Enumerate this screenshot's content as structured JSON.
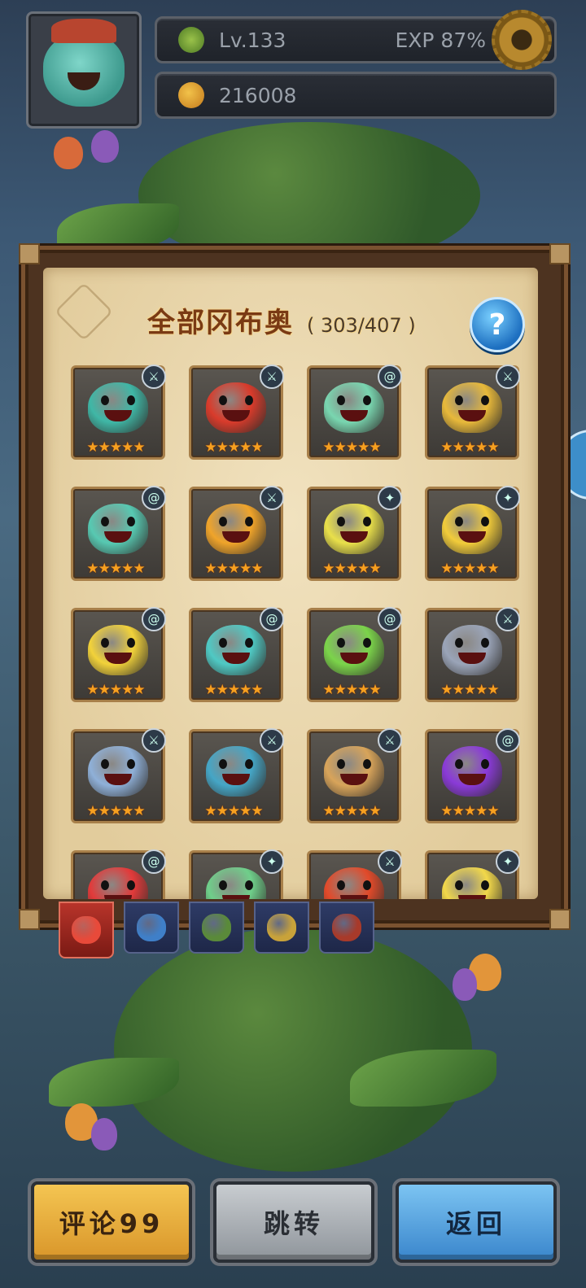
{
  "hud": {
    "level_text": "Lv.133",
    "exp_text": "EXP 87%",
    "coins_text": "216008"
  },
  "panel": {
    "title": "全部冈布奥",
    "count": "( 303/407 )",
    "help_label": "?"
  },
  "cards": [
    {
      "badge": "sword",
      "color": "#3fb7a6",
      "stars": "★★★★★"
    },
    {
      "badge": "sword",
      "color": "#d93b2b",
      "stars": "★★★★★"
    },
    {
      "badge": "spiral",
      "color": "#79d6b0",
      "stars": "★★★★★"
    },
    {
      "badge": "sword",
      "color": "#e8b93a",
      "stars": "★★★★★"
    },
    {
      "badge": "spiral",
      "color": "#57c9b2",
      "stars": "★★★★★"
    },
    {
      "badge": "sword",
      "color": "#f0a42a",
      "stars": "★★★★★"
    },
    {
      "badge": "wand",
      "color": "#e9e04a",
      "stars": "★★★★★"
    },
    {
      "badge": "wand",
      "color": "#f2cc3a",
      "stars": "★★★★★"
    },
    {
      "badge": "spiral",
      "color": "#f2d23a",
      "stars": "★★★★★"
    },
    {
      "badge": "spiral",
      "color": "#4fc9c4",
      "stars": "★★★★★"
    },
    {
      "badge": "spiral",
      "color": "#7bd44a",
      "stars": "★★★★★"
    },
    {
      "badge": "sword",
      "color": "#9aa4b8",
      "stars": "★★★★★"
    },
    {
      "badge": "sword",
      "color": "#8fb0d8",
      "stars": "★★★★★"
    },
    {
      "badge": "sword",
      "color": "#45a6c6",
      "stars": "★★★★★"
    },
    {
      "badge": "sword",
      "color": "#d8a45a",
      "stars": "★★★★★"
    },
    {
      "badge": "spiral",
      "color": "#8a3ad8",
      "stars": "★★★★★"
    },
    {
      "badge": "spiral",
      "color": "#e23a3a",
      "stars": ""
    },
    {
      "badge": "wand",
      "color": "#6fcf8a",
      "stars": ""
    },
    {
      "badge": "sword",
      "color": "#e24a2a",
      "stars": ""
    },
    {
      "badge": "wand",
      "color": "#f2d84a",
      "stars": ""
    }
  ],
  "tabs": [
    {
      "name": "all",
      "active": true,
      "color": "#e84a3a"
    },
    {
      "name": "blue",
      "active": false,
      "color": "#3f7fc8"
    },
    {
      "name": "green",
      "active": false,
      "color": "#5a8a3a"
    },
    {
      "name": "gold",
      "active": false,
      "color": "#c8a23a"
    },
    {
      "name": "red",
      "active": false,
      "color": "#a83a2a"
    }
  ],
  "buttons": {
    "comment_label": "评论99",
    "jump_label": "跳转",
    "back_label": "返回"
  }
}
